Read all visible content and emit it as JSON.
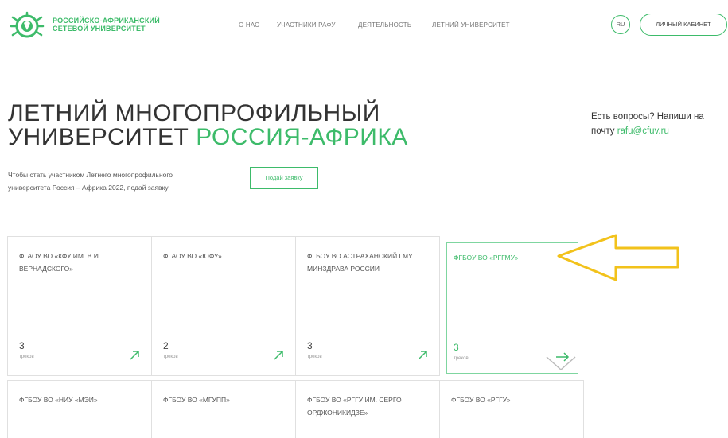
{
  "header": {
    "logo_icon": "globe-leaf-logo",
    "logo_line1": "РОССИЙСКО-АФРИКАНСКИЙ",
    "logo_line2": "СЕТЕВОЙ УНИВЕРСИТЕТ",
    "nav": [
      "О НАС",
      "УЧАСТНИКИ РАФУ",
      "ДЕЯТЕЛЬНОСТЬ",
      "ЛЕТНИЙ УНИВЕРСИТЕТ",
      "···"
    ],
    "lang": "RU",
    "cabinet": "ЛИЧНЫЙ КАБИНЕТ"
  },
  "hero": {
    "title_line1": "ЛЕТНИЙ МНОГОПРОФИЛЬНЫЙ",
    "title_line2_plain": "УНИВЕРСИТЕТ ",
    "title_line2_accent": "РОССИЯ-АФРИКА",
    "questions_line1": "Есть вопросы? Напиши на",
    "questions_line2_prefix": "почту ",
    "questions_email": "rafu@cfuv.ru",
    "intro_line1": "Чтобы стать участником Летнего многопрофильного",
    "intro_line2": "университета Россия – Африка 2022, подай заявку",
    "apply_button": "Подай заявку"
  },
  "cards": [
    {
      "name": "ФГАОУ ВО «КФУ ИМ. В.И. ВЕРНАДСКОГО»",
      "count": "3",
      "sub": "треков"
    },
    {
      "name": "ФГАОУ ВО «ЮФУ»",
      "count": "2",
      "sub": "треков"
    },
    {
      "name": "ФГБОУ ВО АСТРАХАНСКИЙ ГМУ МИНЗДРАВА РОССИИ",
      "count": "3",
      "sub": "треков"
    },
    {
      "name": "ФГБОУ ВО «РГГМУ»",
      "count": "3",
      "sub": "треков"
    },
    {
      "name": "ФГБОУ ВО «НИУ «МЭИ»",
      "count": "",
      "sub": ""
    },
    {
      "name": "ФГБОУ ВО «МГУПП»",
      "count": "",
      "sub": ""
    },
    {
      "name": "ФГБОУ ВО «РГГУ ИМ. СЕРГО ОРДЖОНИКИДЗЕ»",
      "count": "",
      "sub": ""
    },
    {
      "name": "ФГБОУ ВО «РГГУ»",
      "count": "",
      "sub": ""
    }
  ],
  "colors": {
    "accent": "#3dbb6a",
    "annotation": "#f2c21b",
    "border": "#e0e0e0"
  },
  "icons": {
    "card_arrow": "arrow-up-right-icon",
    "hover_arrow": "arrow-right-icon",
    "annotation": "annotation-arrow-left"
  }
}
